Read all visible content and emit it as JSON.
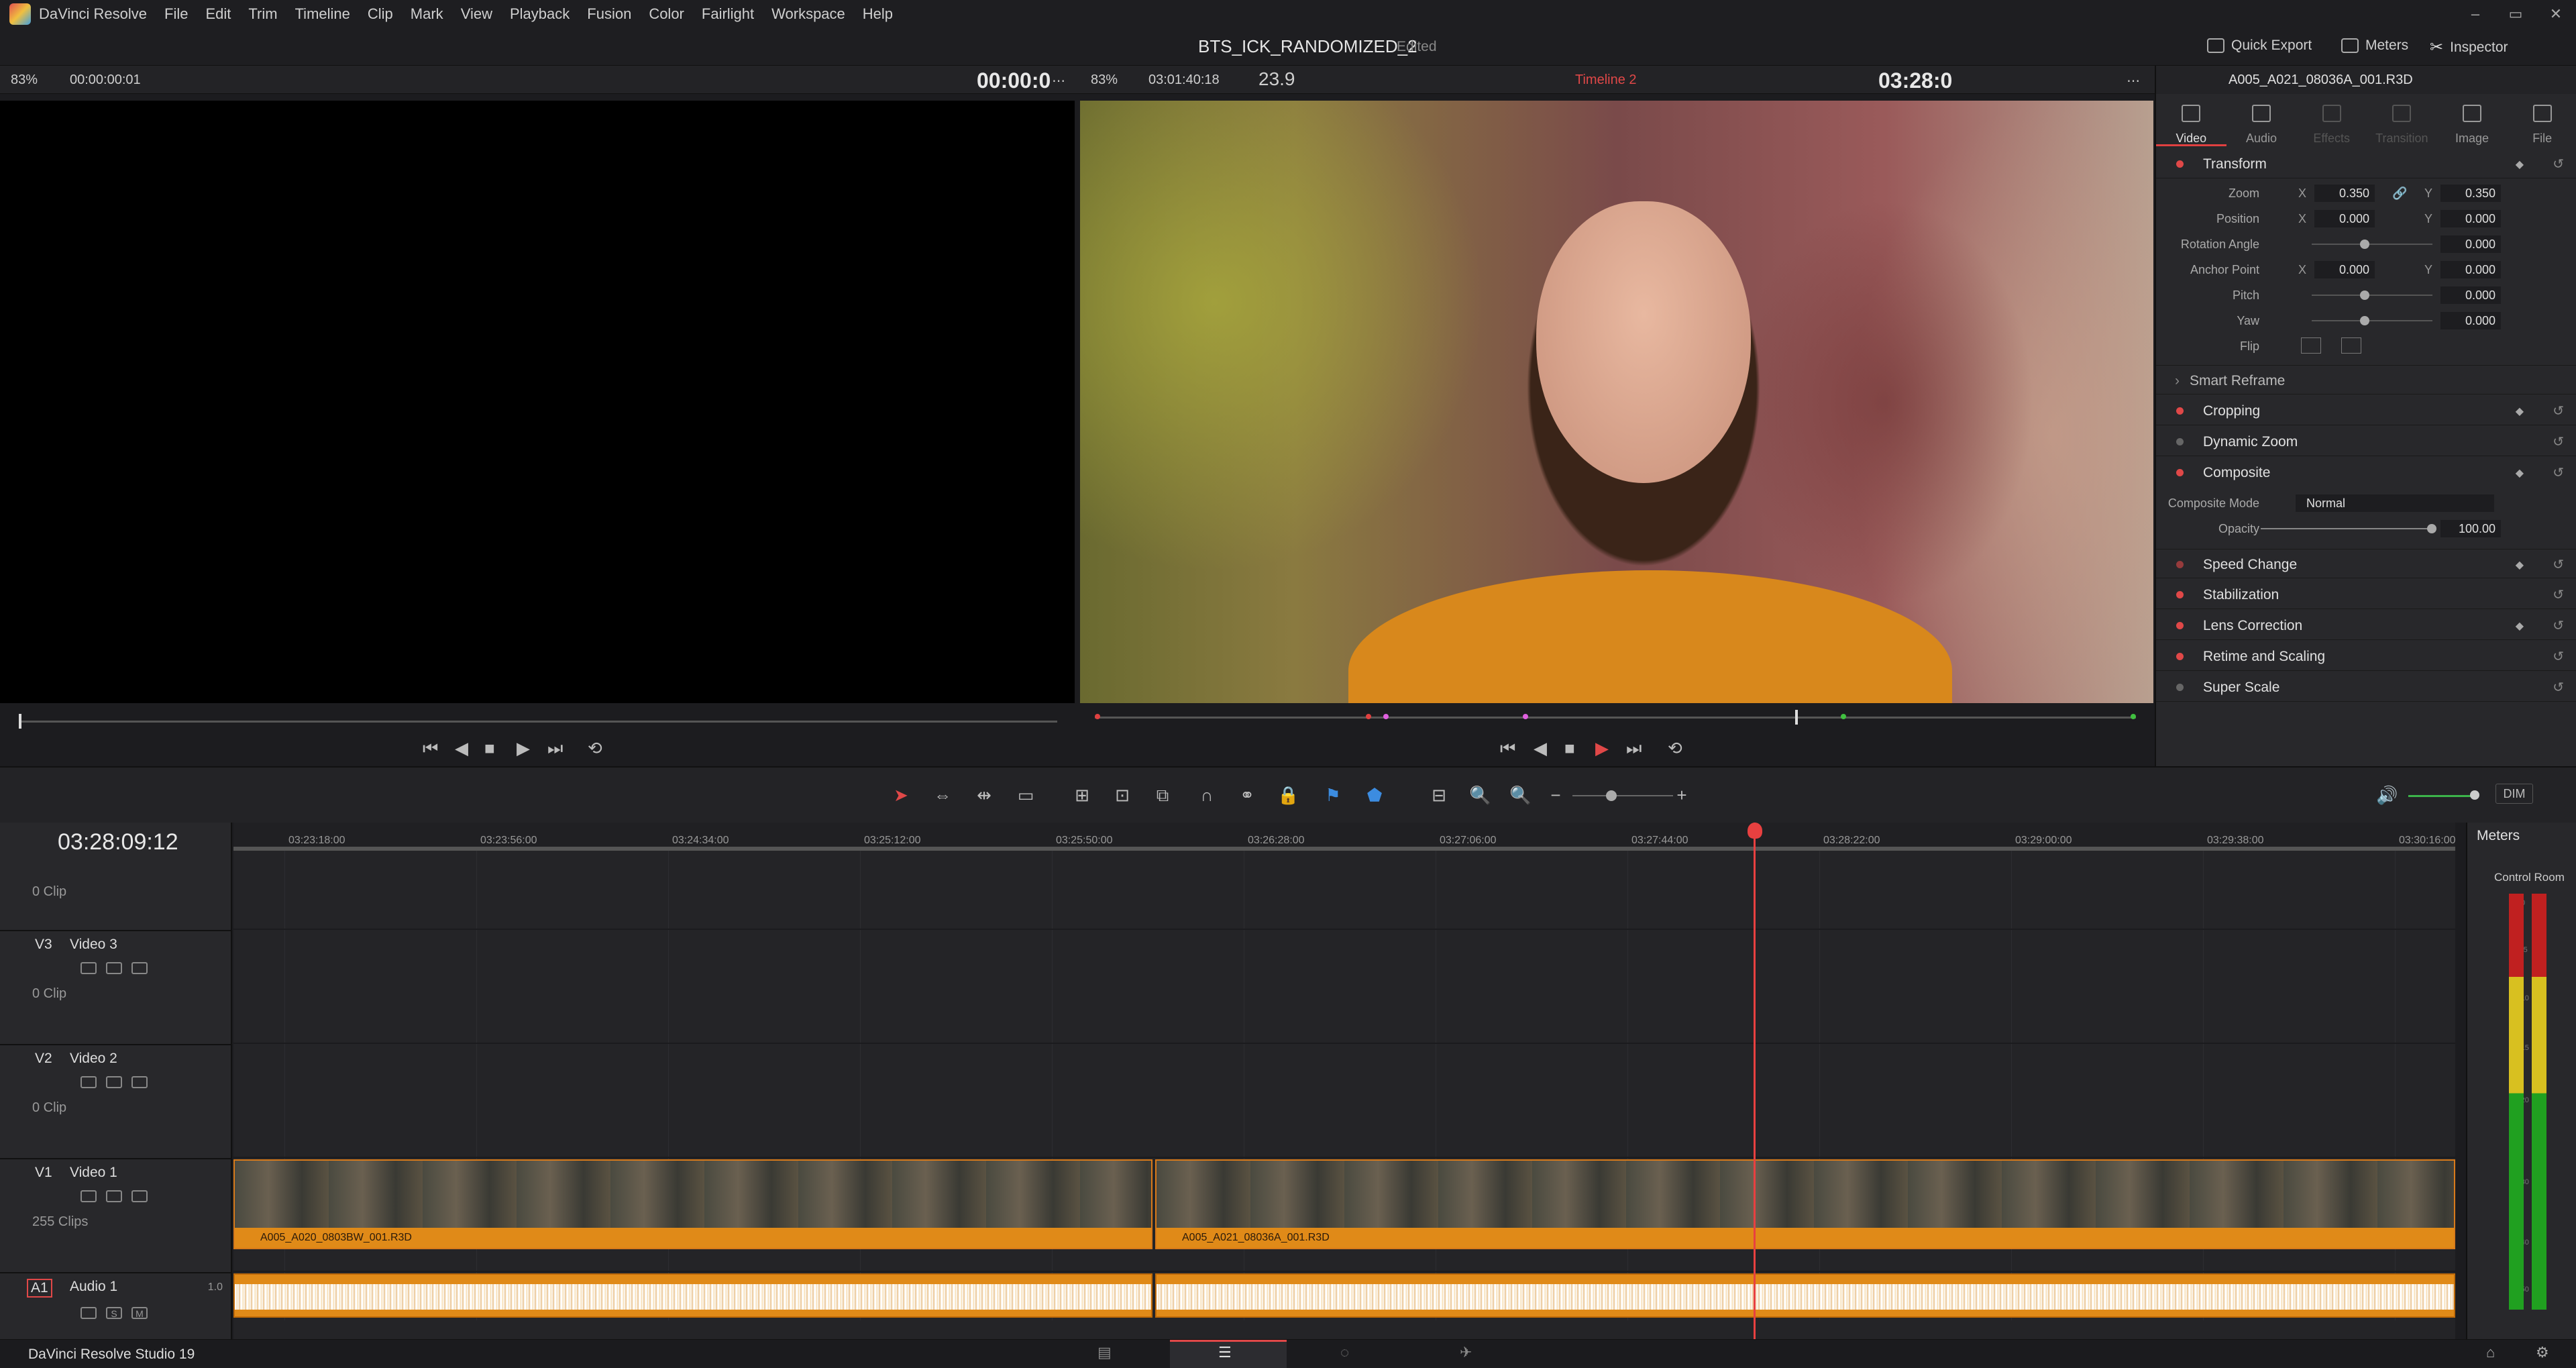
{
  "menubar": {
    "app_name": "DaVinci Resolve",
    "items": [
      "File",
      "Edit",
      "Trim",
      "Timeline",
      "Clip",
      "Mark",
      "View",
      "Playback",
      "Fusion",
      "Color",
      "Fairlight",
      "Workspace",
      "Help"
    ],
    "minimize": "–",
    "maximize": "▭",
    "close": "✕"
  },
  "titlebar": {
    "project": "BTS_ICK_RANDOMIZED_2",
    "status": "Edited",
    "quick_export": "Quick Export",
    "meters": "Meters",
    "inspector": "Inspector"
  },
  "source_viewer": {
    "zoom": "83%",
    "timecode": "00:00:00:01",
    "tc_big": "00:00:0"
  },
  "timeline_viewer": {
    "zoom": "83%",
    "timecode": "03:01:40:18",
    "fps": "23.9",
    "timeline_name": "Timeline 2",
    "tc_big": "03:28:0"
  },
  "inspector": {
    "clip_name": "A005_A021_08036A_001.R3D",
    "tabs": [
      {
        "label": "Video",
        "state": "active"
      },
      {
        "label": "Audio",
        "state": "normal"
      },
      {
        "label": "Effects",
        "state": "disabled"
      },
      {
        "label": "Transition",
        "state": "disabled"
      },
      {
        "label": "Image",
        "state": "normal"
      },
      {
        "label": "File",
        "state": "normal"
      }
    ],
    "transform": {
      "title": "Transform",
      "zoom_label": "Zoom",
      "zoom_x": "0.350",
      "zoom_y": "0.350",
      "position_label": "Position",
      "position_x": "0.000",
      "position_y": "0.000",
      "rotation_label": "Rotation Angle",
      "rotation": "0.000",
      "anchor_label": "Anchor Point",
      "anchor_x": "0.000",
      "anchor_y": "0.000",
      "pitch_label": "Pitch",
      "pitch": "0.000",
      "yaw_label": "Yaw",
      "yaw": "0.000",
      "flip_label": "Flip",
      "x": "X",
      "y": "Y"
    },
    "smart_reframe": "Smart Reframe",
    "cropping": "Cropping",
    "dynamic_zoom": "Dynamic Zoom",
    "composite": {
      "title": "Composite",
      "mode_label": "Composite Mode",
      "mode_value": "Normal",
      "opacity_label": "Opacity",
      "opacity_value": "100.00"
    },
    "speed_change": "Speed Change",
    "stabilization": "Stabilization",
    "lens_correction": "Lens Correction",
    "retime_scaling": "Retime and Scaling",
    "super_scale": "Super Scale"
  },
  "toolbar": {
    "dim": "DIM"
  },
  "timeline": {
    "timecode": "03:28:09:12",
    "ruler": [
      "03:23:18:00",
      "03:23:56:00",
      "03:24:34:00",
      "03:25:12:00",
      "03:25:50:00",
      "03:26:28:00",
      "03:27:06:00",
      "03:27:44:00",
      "03:28:22:00",
      "03:29:00:00",
      "03:29:38:00",
      "03:30:16:00"
    ],
    "tracks": {
      "top_clips": "0 Clip",
      "v3": {
        "id": "V3",
        "name": "Video 3",
        "clips": "0 Clip"
      },
      "v2": {
        "id": "V2",
        "name": "Video 2",
        "clips": "0 Clip"
      },
      "v1": {
        "id": "V1",
        "name": "Video 1",
        "clips": "255 Clips"
      },
      "a1": {
        "id": "A1",
        "name": "Audio 1",
        "level": "1.0",
        "solo": "S",
        "mute": "M"
      }
    },
    "clip1": "A005_A020_0803BW_001.R3D",
    "clip2": "A005_A021_08036A_001.R3D"
  },
  "meters": {
    "title": "Meters",
    "control_room": "Control Room",
    "scale": [
      "0",
      "-5",
      "-10",
      "-15",
      "-20",
      "-30",
      "-40",
      "-50"
    ]
  },
  "bottombar": {
    "app": "DaVinci Resolve Studio 19"
  }
}
